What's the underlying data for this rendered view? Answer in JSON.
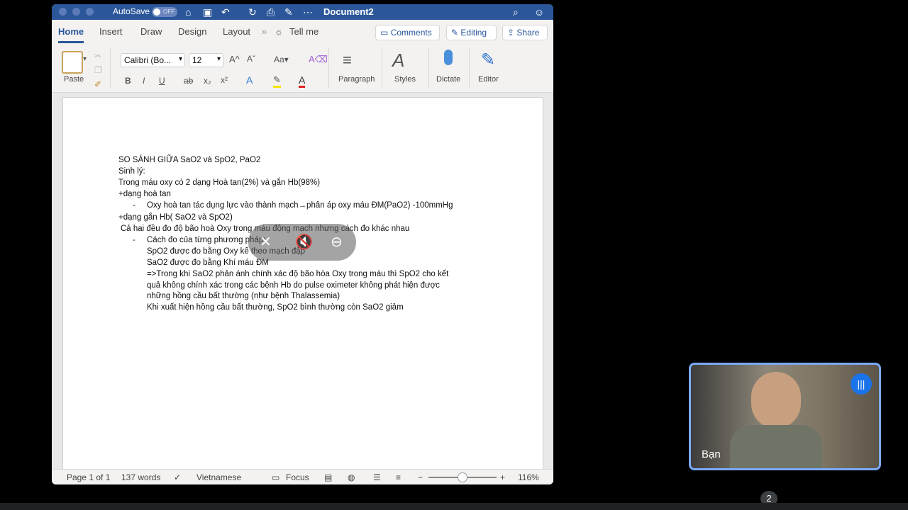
{
  "titlebar": {
    "autosave_label": "AutoSave",
    "autosave_state": "OFF",
    "doc_title": "Document2",
    "icons": [
      "home-icon",
      "save-icon",
      "undo-icon",
      "redo-icon",
      "print-icon",
      "edit-icon",
      "more-icon",
      "search-icon",
      "share-people-icon"
    ]
  },
  "tabs": [
    "Home",
    "Insert",
    "Draw",
    "Design",
    "Layout"
  ],
  "tell_me": "Tell me",
  "actions": {
    "comments": "Comments",
    "editing": "Editing",
    "share": "Share"
  },
  "ribbon": {
    "paste": "Paste",
    "font_name": "Calibri (Bo...",
    "font_size": "12",
    "paragraph": "Paragraph",
    "styles": "Styles",
    "dictate": "Dictate",
    "editor": "Editor"
  },
  "document": {
    "lines": [
      {
        "text": "SO SÁNH GIỮA SaO2 và SpO2, PaO2"
      },
      {
        "text": "Sinh lý:"
      },
      {
        "text": "Trong máu oxy có 2 dạng Hoà tan(2%) và gắn Hb(98%)"
      },
      {
        "text": "+dạng hoà tan"
      },
      {
        "text": "-"
      },
      {
        "text": "Oxy hoà tan tác dụng lực vào thành mạch→phân áp oxy máu ĐM(PaO2) -100mmHg"
      },
      {
        "text": "+dạng gắn Hb( SaO2 và SpO2)"
      },
      {
        "text": "Cả hai đều đo độ bão hoà Oxy trong máu động mạch nhưng cách đo khác nhau"
      },
      {
        "text": "-"
      },
      {
        "text": "Cách đo của từng phương pháp:"
      },
      {
        "text": "SpO2 được đo bằng Oxy kế theo mạch đập"
      },
      {
        "text": "SaO2 được đo bằng Khí máu ĐM"
      },
      {
        "text": "=>Trong khi SaO2 phản ánh chính xác độ bão hòa Oxy trong máu thì SpO2 cho kết"
      },
      {
        "text": "quả không chính xác trong các bệnh Hb do pulse oximeter không phát hiện được"
      },
      {
        "text": "những hồng cầu bất thường (như bệnh Thalassemia)"
      },
      {
        "text": "Khi xuất hiện hồng cầu bất thường, SpO2 bình thường còn SaO2 giảm"
      }
    ]
  },
  "status": {
    "page": "Page 1 of 1",
    "words": "137 words",
    "language": "Vietnamese",
    "focus": "Focus",
    "zoom": "116%",
    "zoom_minus": "−",
    "zoom_plus": "+",
    "zoom_level_fraction": 0.5
  },
  "video": {
    "name": "Bạn"
  },
  "participant_count": "2",
  "colors": {
    "word_blue": "#2b579a",
    "video_border": "#7baaf7",
    "meet_blue": "#1a73e8"
  }
}
